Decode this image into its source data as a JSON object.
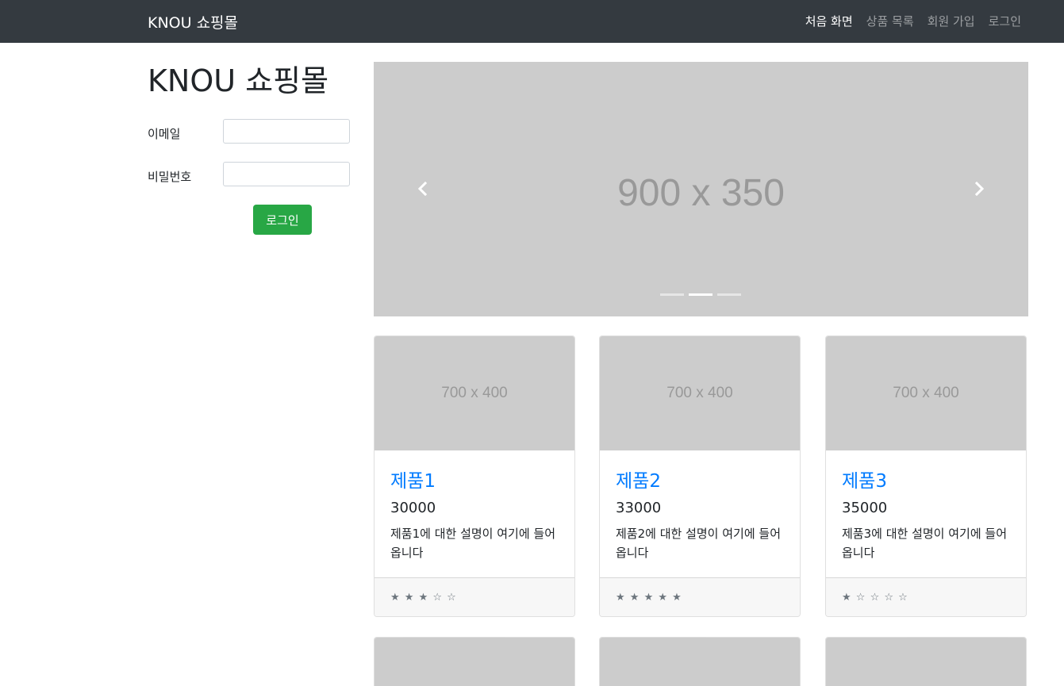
{
  "navbar": {
    "brand": "KNOU 쇼핑몰",
    "links": [
      {
        "label": "처음 화면",
        "active": true
      },
      {
        "label": "상품 목록",
        "active": false
      },
      {
        "label": "회원 가입",
        "active": false
      },
      {
        "label": "로그인",
        "active": false
      }
    ]
  },
  "sidebar": {
    "title": "KNOU 쇼핑몰",
    "email_label": "이메일",
    "email_value": "",
    "password_label": "비밀번호",
    "password_value": "",
    "login_button": "로그인"
  },
  "carousel": {
    "placeholder_label": "900 x 350",
    "prev_icon": "chevron-left-icon",
    "next_icon": "chevron-right-icon",
    "slide_count": 3,
    "active_index": 1
  },
  "products": [
    {
      "image_label": "700 x 400",
      "title": "제품1",
      "price": "30000",
      "description": "제품1에 대한 설명이 여기에 들어옵니다",
      "stars": "★ ★ ★ ☆ ☆",
      "rating": 3
    },
    {
      "image_label": "700 x 400",
      "title": "제품2",
      "price": "33000",
      "description": "제품2에 대한 설명이 여기에 들어옵니다",
      "stars": "★ ★ ★ ★ ★",
      "rating": 5
    },
    {
      "image_label": "700 x 400",
      "title": "제품3",
      "price": "35000",
      "description": "제품3에 대한 설명이 여기에 들어옵니다",
      "stars": "★ ☆ ☆ ☆ ☆",
      "rating": 1
    }
  ],
  "colors": {
    "navbar_bg": "#343a40",
    "login_button": "#28a745",
    "link": "#007bff",
    "placeholder_bg": "#cccccc"
  }
}
